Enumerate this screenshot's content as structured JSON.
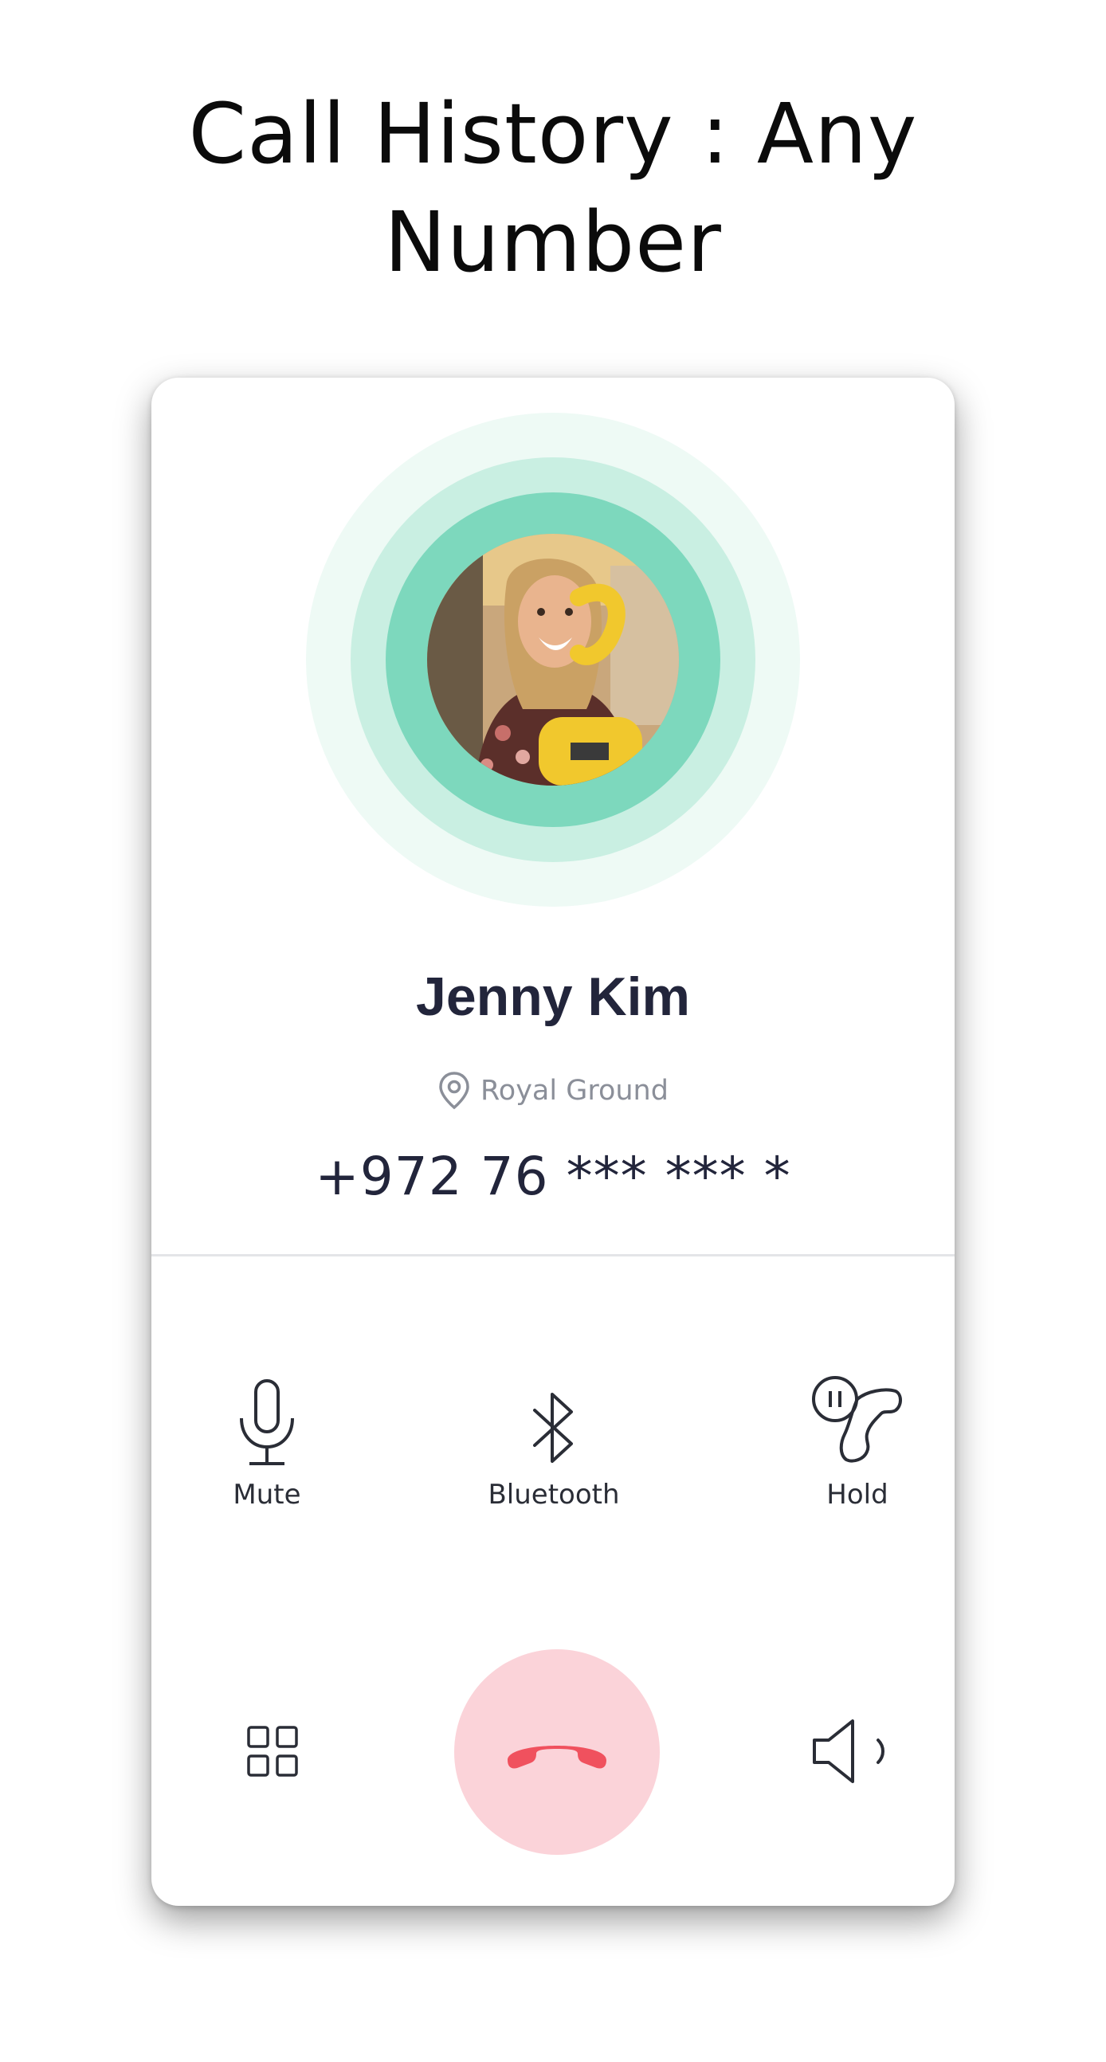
{
  "headline": {
    "line1": "Call History : Any",
    "line2": "Number"
  },
  "contact": {
    "name": "Jenny Kim",
    "location": "Royal Ground",
    "phone": "+972 76 *** *** *"
  },
  "actions": {
    "mute_label": "Mute",
    "bluetooth_label": "Bluetooth",
    "hold_label": "Hold"
  },
  "colors": {
    "accent_green": "#7dd8bd",
    "end_call": "#f0515e",
    "end_call_bg": "#fbd3d9",
    "text_dark": "#22253b"
  },
  "icons": {
    "location": "map-pin-icon",
    "mute": "microphone-icon",
    "bluetooth": "bluetooth-icon",
    "hold": "phone-hold-icon",
    "dialpad": "dialpad-grid-icon",
    "end_call": "end-call-icon",
    "speaker": "speaker-icon"
  }
}
